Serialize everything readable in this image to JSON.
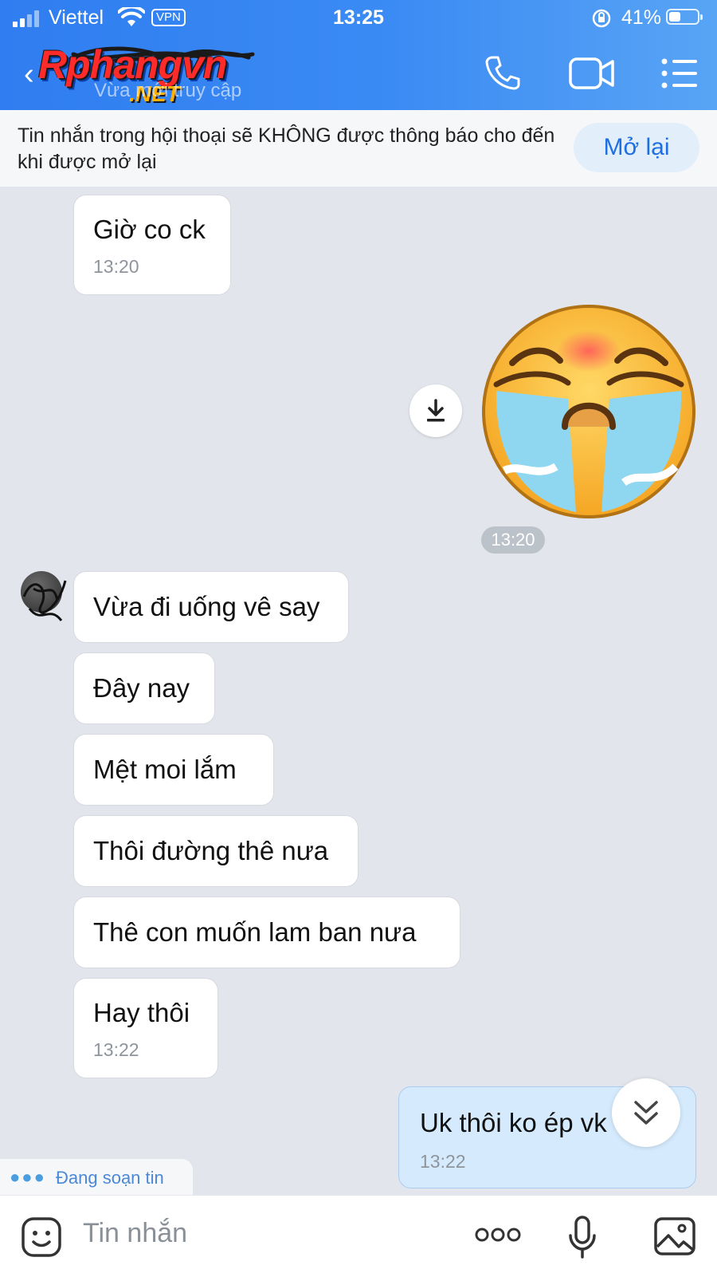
{
  "status_bar": {
    "carrier": "Viettel",
    "vpn": "VPN",
    "time": "13:25",
    "battery": "41%",
    "battery_level": 0.41
  },
  "header": {
    "watermark_logo": "Rphangvn",
    "watermark_sub": ".NET",
    "subtitle": "Vừa mới truy cập",
    "icons": [
      "back-icon",
      "phone-icon",
      "video-call-icon",
      "menu-icon"
    ]
  },
  "notice": {
    "text": "Tin nhắn trong hội thoại sẽ KHÔNG được thông báo cho đến khi được mở lại",
    "button": "Mở lại"
  },
  "messages": {
    "m1": {
      "text": "Giờ co ck",
      "time": "13:20"
    },
    "sticker_time": "13:20",
    "m2": {
      "text": "Vừa đi uống vê say"
    },
    "m3": {
      "text": "Đây nay"
    },
    "m4": {
      "text": "Mệt moi lắm"
    },
    "m5": {
      "text": "Thôi đường thê nưa"
    },
    "m6": {
      "text": "Thê con muốn lam ban nưa"
    },
    "m7": {
      "text": "Hay thôi",
      "time": "13:22"
    },
    "sent1": {
      "text": "Uk thôi ko ép vk",
      "time": "13:22"
    }
  },
  "typing_indicator": "Đang soạn tin",
  "input": {
    "placeholder": "Tin nhắn",
    "icons": [
      "sticker-icon",
      "more-icon",
      "microphone-icon",
      "image-icon"
    ]
  },
  "colors": {
    "header_blue": "#2f7df0",
    "accent": "#1e6fe0",
    "sent_bubble": "#d5ebfd",
    "chat_bg": "#e2e6ec"
  }
}
